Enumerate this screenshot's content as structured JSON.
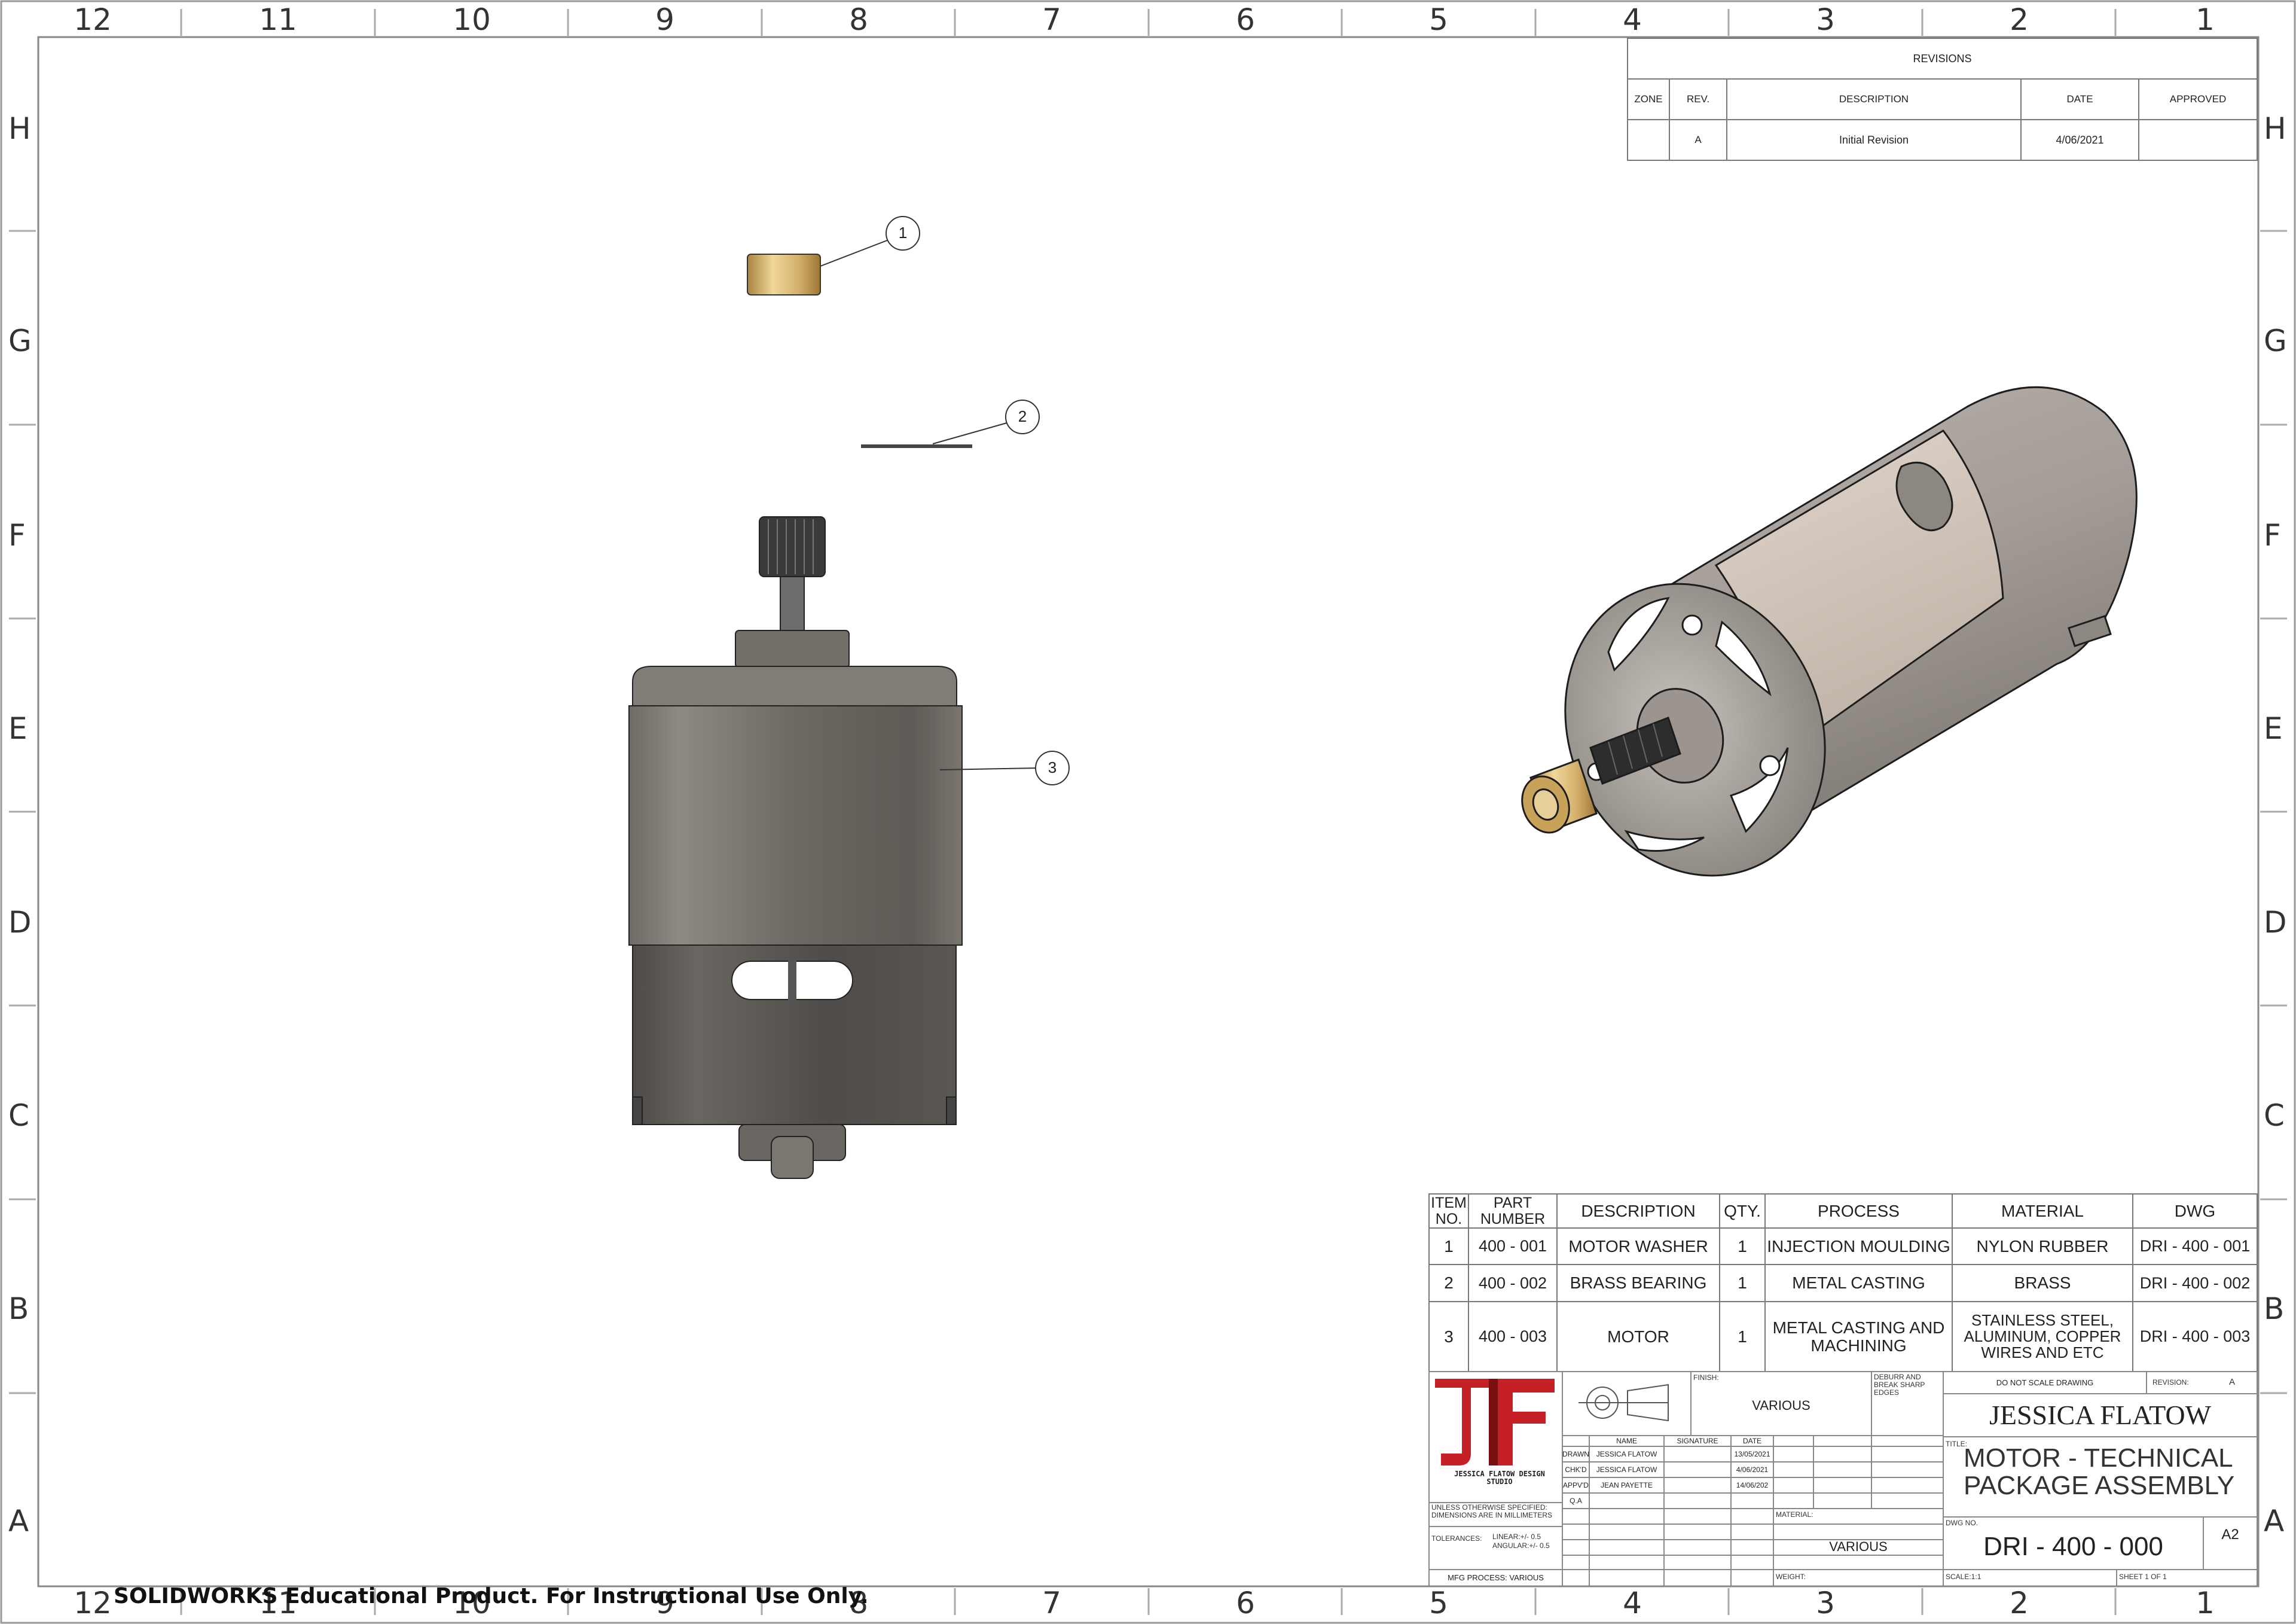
{
  "border": {
    "column_numbers": [
      "12",
      "11",
      "10",
      "9",
      "8",
      "7",
      "6",
      "5",
      "4",
      "3",
      "2",
      "1"
    ],
    "row_letters": [
      "H",
      "G",
      "F",
      "E",
      "D",
      "C",
      "B",
      "A"
    ]
  },
  "revisions": {
    "title": "REVISIONS",
    "headers": [
      "ZONE",
      "REV.",
      "DESCRIPTION",
      "DATE",
      "APPROVED"
    ],
    "rows": [
      {
        "zone": "",
        "rev": "A",
        "description": "Initial Revision",
        "date": "4/06/2021",
        "approved": ""
      }
    ]
  },
  "balloons": [
    "1",
    "2",
    "3"
  ],
  "bom": {
    "headers": {
      "item": "ITEM NO.",
      "part": "PART NUMBER",
      "description": "DESCRIPTION",
      "qty": "QTY.",
      "process": "PROCESS",
      "material": "MATERIAL",
      "dwg": "DWG"
    },
    "rows": [
      {
        "item": "1",
        "part": "400 - 001",
        "description": "MOTOR WASHER",
        "qty": "1",
        "process": "INJECTION MOULDING",
        "material": "NYLON RUBBER",
        "dwg": "DRI - 400 - 001"
      },
      {
        "item": "2",
        "part": "400 - 002",
        "description": "BRASS BEARING",
        "qty": "1",
        "process": "METAL CASTING",
        "material": "BRASS",
        "dwg": "DRI - 400 - 002"
      },
      {
        "item": "3",
        "part": "400 - 003",
        "description": "MOTOR",
        "qty": "1",
        "process": "METAL CASTING AND MACHINING",
        "material": "STAINLESS STEEL, ALUMINUM, COPPER WIRES AND ETC",
        "dwg": "DRI - 400 - 003"
      }
    ]
  },
  "title_block": {
    "logo_letters": "JF",
    "studio_name": "JESSICA FLATOW DESIGN STUDIO",
    "finish_label": "FINISH:",
    "finish_value": "VARIOUS",
    "deburr_note": "DEBURR AND BREAK SHARP EDGES",
    "do_not_scale": "DO NOT SCALE DRAWING",
    "revision_label": "REVISION:",
    "revision_value": "A",
    "company": "JESSICA FLATOW",
    "title_label": "TITLE:",
    "title_line1": "MOTOR - TECHNICAL",
    "title_line2": "PACKAGE ASSEMBLY",
    "sig_headers": [
      "NAME",
      "SIGNATURE",
      "DATE"
    ],
    "sig_rows": [
      {
        "role": "DRAWN",
        "name": "JESSICA FLATOW",
        "date": "13/05/2021"
      },
      {
        "role": "CHK'D",
        "name": "JESSICA FLATOW",
        "date": "4/06/2021"
      },
      {
        "role": "APPV'D",
        "name": "JEAN PAYETTE",
        "date": "14/06/202"
      },
      {
        "role": "Q.A",
        "name": "",
        "date": ""
      }
    ],
    "unless_note": "UNLESS OTHERWISE SPECIFIED: DIMENSIONS ARE IN MILLIMETERS",
    "tolerances_label": "TOLERANCES:",
    "tol_linear": "LINEAR:+/- 0.5",
    "tol_angular": "ANGULAR:+/- 0.5",
    "mfg_process": "MFG PROCESS: VARIOUS",
    "material_label": "MATERIAL:",
    "material_value": "VARIOUS",
    "weight_label": "WEIGHT:",
    "dwg_no_label": "DWG NO.",
    "dwg_no": "DRI - 400 - 000",
    "size": "A2",
    "scale": "SCALE:1:1",
    "sheet": "SHEET 1 OF 1"
  },
  "educational_note": "SOLIDWORKS Educational Product. For Instructional Use Only."
}
